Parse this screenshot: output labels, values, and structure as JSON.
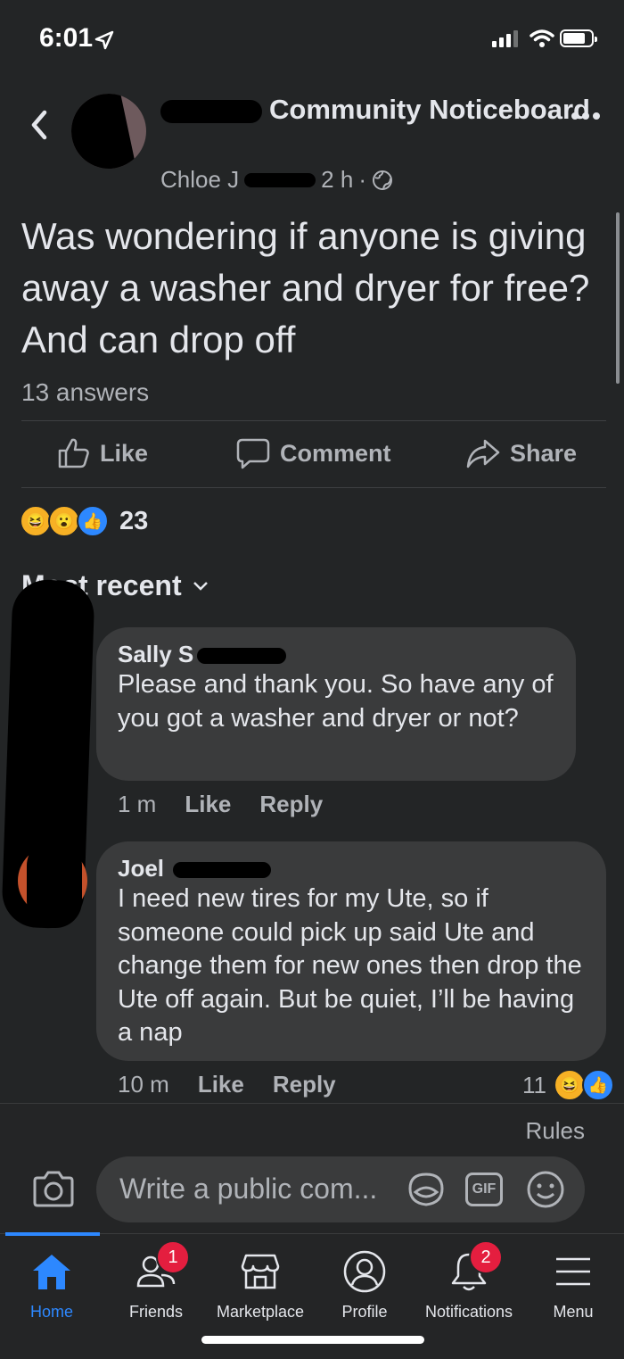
{
  "status_bar": {
    "time": "6:01"
  },
  "header": {
    "group_name": "Community Noticeboard",
    "author": "Chloe J",
    "age": "2 h",
    "separator": "·"
  },
  "post": {
    "text": "Was wondering if anyone is giving away a washer and dryer for free? And can drop off",
    "answers": "13 answers"
  },
  "actions": {
    "like": "Like",
    "comment": "Comment",
    "share": "Share"
  },
  "reactions": {
    "count": "23",
    "types": [
      "haha",
      "wow",
      "like"
    ]
  },
  "sort": {
    "label": "Most recent"
  },
  "comments": [
    {
      "author": "Sally S",
      "text": "Please and thank you. So have any of you got a washer and dryer or not?",
      "age": "1 m",
      "like": "Like",
      "reply": "Reply"
    },
    {
      "author": "Joel",
      "text": "I need new tires for my Ute, so if someone could pick up said Ute and change them for new ones then drop the Ute off again. But be quiet, I’ll be having a nap",
      "age": "10 m",
      "like": "Like",
      "reply": "Reply",
      "reaction_count": "11"
    }
  ],
  "composer": {
    "rules": "Rules",
    "placeholder": "Write a public com...",
    "gif": "GIF"
  },
  "tabs": [
    {
      "label": "Home"
    },
    {
      "label": "Friends",
      "badge": "1"
    },
    {
      "label": "Marketplace"
    },
    {
      "label": "Profile"
    },
    {
      "label": "Notifications",
      "badge": "2"
    },
    {
      "label": "Menu"
    }
  ],
  "colors": {
    "accent": "#2d88ff",
    "badge": "#e41e3f",
    "background": "#232526",
    "bubble": "#3a3b3c"
  }
}
